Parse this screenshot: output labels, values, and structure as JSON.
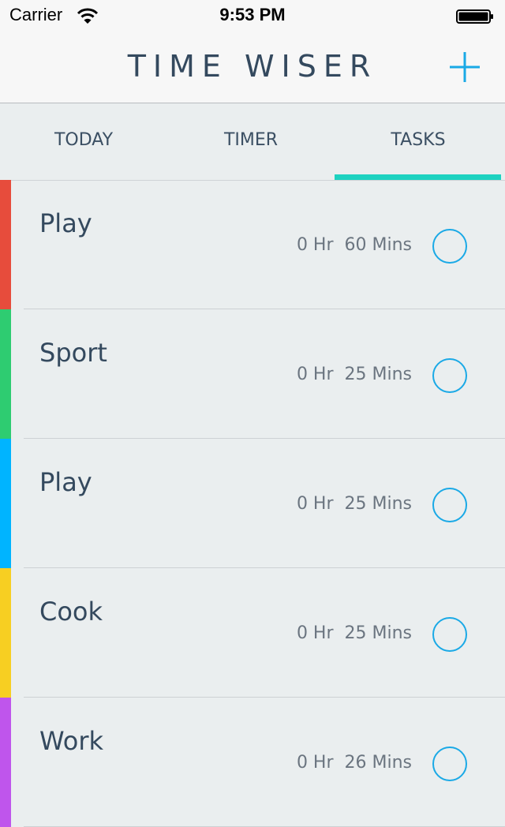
{
  "status_bar": {
    "carrier": "Carrier",
    "time": "9:53 PM",
    "icons": [
      "wifi-icon",
      "battery-icon"
    ]
  },
  "header": {
    "title": "TIME WISER",
    "add_icon": "plus-icon",
    "accent_color": "#1aa9e6"
  },
  "tabs": [
    {
      "label": "TODAY",
      "active": false
    },
    {
      "label": "TIMER",
      "active": false
    },
    {
      "label": "TASKS",
      "active": true
    }
  ],
  "tab_indicator_color": "#1dd2c0",
  "tasks": [
    {
      "name": "Play",
      "duration": "0 Hr  60 Mins",
      "color": "#e74c3c",
      "done": false
    },
    {
      "name": "Sport",
      "duration": "0 Hr  25 Mins",
      "color": "#2ecc71",
      "done": false
    },
    {
      "name": "Play",
      "duration": "0 Hr  25 Mins",
      "color": "#00b4ff",
      "done": false
    },
    {
      "name": "Cook",
      "duration": "0 Hr  25 Mins",
      "color": "#f7cf22",
      "done": false
    },
    {
      "name": "Work",
      "duration": "0 Hr  26 Mins",
      "color": "#bf55ec",
      "done": false
    }
  ]
}
